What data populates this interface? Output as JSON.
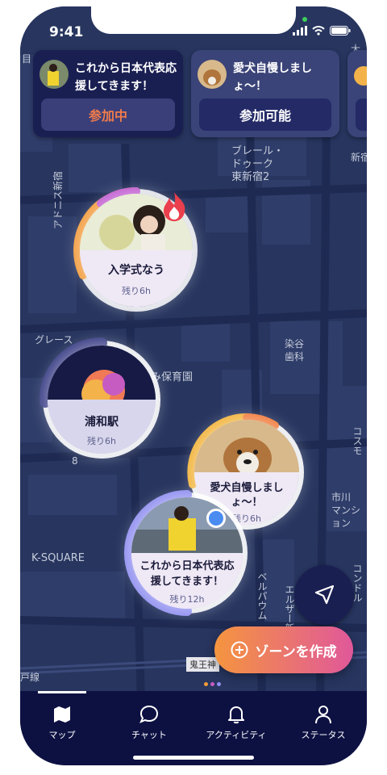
{
  "status_bar": {
    "time": "9:41"
  },
  "zone_cards": [
    {
      "title": "これから日本代表応援してきます！",
      "button": "参加中",
      "button_color": "#f07b4a"
    },
    {
      "title": "愛犬自慢しましょ〜！",
      "button": "参加可能",
      "button_color": "#ffffff"
    }
  ],
  "map_labels": [
    "目",
    "大",
    "新宿",
    "ブレール・\nドゥーク\n東新宿2",
    "アドニス新宿",
    "グレース",
    "染谷\n歯科",
    "み保育園",
    "コスモ",
    "市川\nマンション",
    "K-SQUARE",
    "ベルパウム",
    "エルザー新宿",
    "コンドル",
    "鬼王神",
    "戸線",
    "8"
  ],
  "zones": [
    {
      "title": "入学式なう",
      "remaining": "残り6h",
      "progress": 0.35,
      "ring_color": "#f29a3a",
      "badge": "fire-icon"
    },
    {
      "title": "浦和駅",
      "remaining": "残り6h",
      "progress": 0.3,
      "ring_color": "#3b3f86"
    },
    {
      "title": "愛犬自慢しましょ〜！",
      "remaining": "残り6h",
      "progress": 0.4,
      "ring_color": "#f2b33a"
    },
    {
      "title": "これから日本代表応援してきます！",
      "remaining": "残り12h",
      "progress": 0.55,
      "ring_color": "#8f8ef0"
    }
  ],
  "fab": {
    "label": "ゾーンを作成"
  },
  "nav": [
    {
      "label": "マップ",
      "active": true
    },
    {
      "label": "チャット",
      "active": false
    },
    {
      "label": "アクティビティ",
      "active": false
    },
    {
      "label": "ステータス",
      "active": false
    }
  ]
}
